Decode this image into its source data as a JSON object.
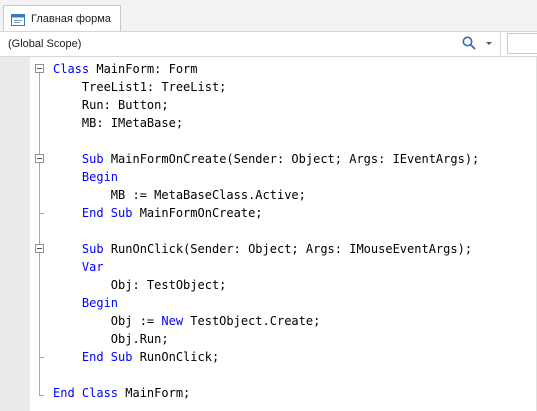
{
  "tab": {
    "label": "Главная форма",
    "icon": "form-window-icon"
  },
  "scope": {
    "selected": "(Global Scope)",
    "search_icon": "search-icon",
    "arrow_icon": "chevron-down-icon"
  },
  "method": {
    "selected": ""
  },
  "colors": {
    "keyword": "#0000ff",
    "text": "#000000",
    "gutter": "#ebebeb"
  },
  "code": {
    "lines": [
      [
        {
          "t": "Class",
          "k": true
        },
        {
          "t": " MainForm: Form"
        }
      ],
      [
        {
          "t": "    TreeList1: TreeList;"
        }
      ],
      [
        {
          "t": "    Run: Button;"
        }
      ],
      [
        {
          "t": "    MB: IMetaBase;"
        }
      ],
      [
        {
          "t": ""
        }
      ],
      [
        {
          "t": "    "
        },
        {
          "t": "Sub",
          "k": true
        },
        {
          "t": " MainFormOnCreate(Sender: Object; Args: IEventArgs);"
        }
      ],
      [
        {
          "t": "    "
        },
        {
          "t": "Begin",
          "k": true
        }
      ],
      [
        {
          "t": "        MB := MetaBaseClass.Active;"
        }
      ],
      [
        {
          "t": "    "
        },
        {
          "t": "End Sub",
          "k": true
        },
        {
          "t": " MainFormOnCreate;"
        }
      ],
      [
        {
          "t": ""
        }
      ],
      [
        {
          "t": "    "
        },
        {
          "t": "Sub",
          "k": true
        },
        {
          "t": " RunOnClick(Sender: Object; Args: IMouseEventArgs);"
        }
      ],
      [
        {
          "t": "    "
        },
        {
          "t": "Var",
          "k": true
        }
      ],
      [
        {
          "t": "        Obj: TestObject;"
        }
      ],
      [
        {
          "t": "    "
        },
        {
          "t": "Begin",
          "k": true
        }
      ],
      [
        {
          "t": "        Obj := "
        },
        {
          "t": "New",
          "k": true
        },
        {
          "t": " TestObject.Create;"
        }
      ],
      [
        {
          "t": "        Obj.Run;"
        }
      ],
      [
        {
          "t": "    "
        },
        {
          "t": "End Sub",
          "k": true
        },
        {
          "t": " RunOnClick;"
        }
      ],
      [
        {
          "t": ""
        }
      ],
      [
        {
          "t": "End Class",
          "k": true
        },
        {
          "t": " MainForm;"
        }
      ]
    ]
  }
}
